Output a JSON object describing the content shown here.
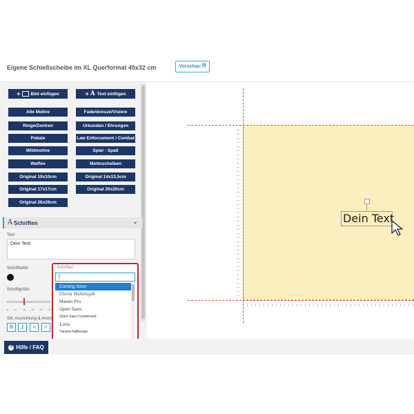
{
  "header": {
    "title": "Eigene Schießscheibe im XL Querformat 45x32 cm",
    "preview_label": "Vorschau"
  },
  "toolbar": {
    "add_image_label": "Bild einfügen",
    "add_text_label": "Text einfügen"
  },
  "categories": [
    "Alle Motive",
    "Fadenkreuze/Visiere",
    "Ringe/Zentren",
    "Urkunden / Ehrungen",
    "Pokale",
    "Law Enforcement / Combat",
    "Wildmotive",
    "Spiel - Spaß",
    "Waffen",
    "Mottoscheiben",
    "Original 10x10cm",
    "Original 14x13,5cm",
    "Original 17x17cm",
    "Original 20x20cm",
    "Original 26x26cm"
  ],
  "fonts_section": {
    "title": "Schriften",
    "text_label": "Text",
    "text_value": "Dein Text",
    "color_label": "Schriftfarbe",
    "size_label": "Schriftgröße",
    "style_label": "Stil, Ausrichtung & Anordnung",
    "font_label": "Schriftart",
    "font_search_value": "|",
    "slider_ticks": [
      "8",
      "10",
      "15",
      "18",
      "30",
      "40"
    ],
    "style_buttons": [
      "B",
      "I",
      "≡",
      "≡"
    ]
  },
  "font_options": [
    "Coming Soon",
    "Gloria Hallelujah",
    "Maven Pro",
    "Open Sans",
    "Open Sans Condensed",
    "Lora",
    "Yanone Kaffeesatz"
  ],
  "footer": {
    "help_label": "Hilfe / FAQ"
  },
  "canvas": {
    "text_object": "Dein Text"
  },
  "colors": {
    "navy": "#1c3666",
    "accent_blue": "#2a9bd0",
    "highlight_red": "#c7252e",
    "target_fill": "#fcefbe"
  }
}
